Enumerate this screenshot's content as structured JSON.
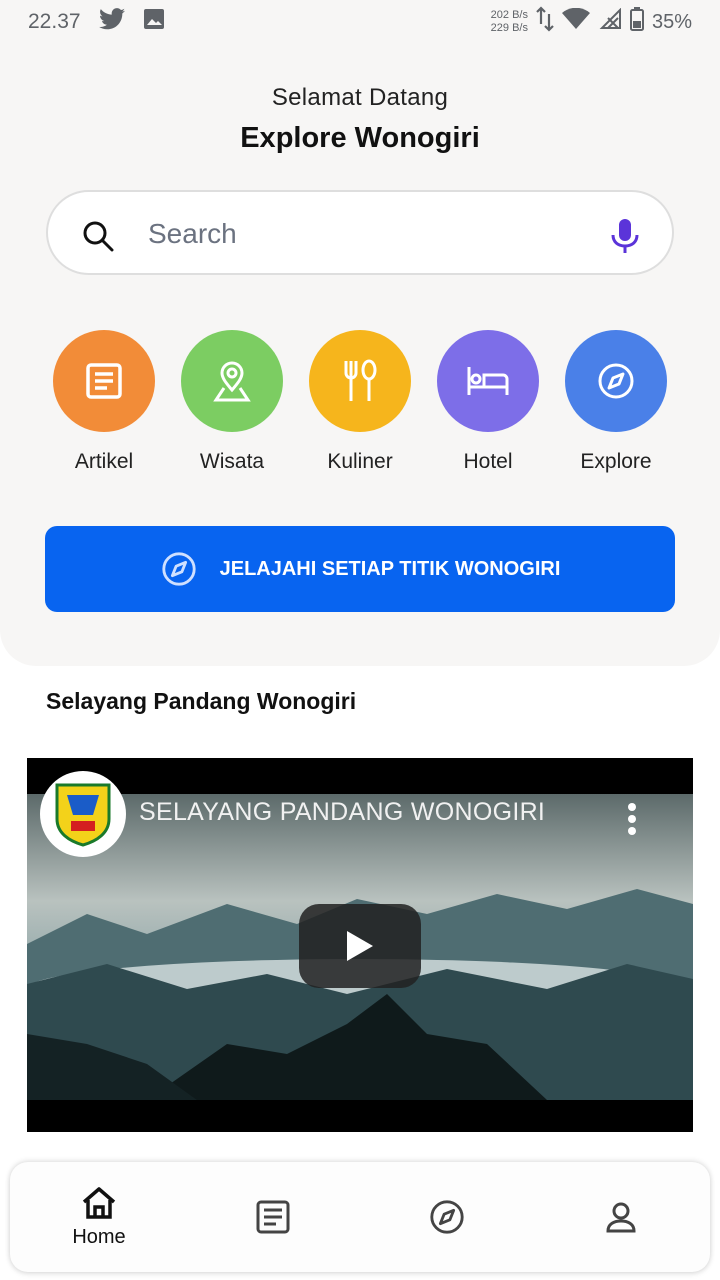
{
  "status_bar": {
    "time": "22.37",
    "net_up": "202 B/s",
    "net_down": "229 B/s",
    "battery": "35%"
  },
  "header": {
    "welcome": "Selamat Datang",
    "title": "Explore Wonogiri"
  },
  "search": {
    "placeholder": "Search"
  },
  "categories": [
    {
      "label": "Artikel",
      "color": "#f28c38",
      "icon": "article-icon"
    },
    {
      "label": "Wisata",
      "color": "#7ccd62",
      "icon": "location-pin-icon"
    },
    {
      "label": "Kuliner",
      "color": "#f6b51c",
      "icon": "fork-spoon-icon"
    },
    {
      "label": "Hotel",
      "color": "#7d6ee8",
      "icon": "bed-icon"
    },
    {
      "label": "Explore",
      "color": "#4a80e8",
      "icon": "compass-icon"
    }
  ],
  "cta": {
    "label": "JELAJAHI SETIAP TITIK WONOGIRI",
    "color": "#0864f0"
  },
  "section": {
    "title": "Selayang Pandang Wonogiri"
  },
  "video": {
    "title": "SELAYANG PANDANG WONOGIRI"
  },
  "bottom_nav": {
    "items": [
      {
        "label": "Home",
        "icon": "home-icon",
        "active": true
      },
      {
        "label": "",
        "icon": "article-icon",
        "active": false
      },
      {
        "label": "",
        "icon": "compass-icon",
        "active": false
      },
      {
        "label": "",
        "icon": "profile-icon",
        "active": false
      }
    ]
  }
}
